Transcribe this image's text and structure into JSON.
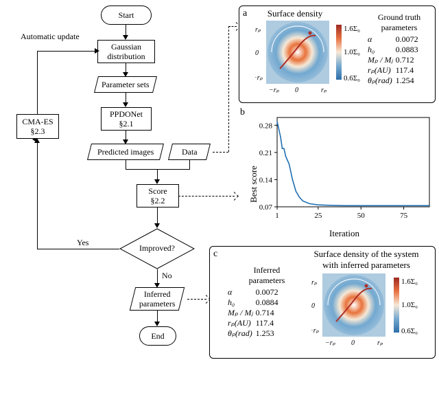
{
  "flow": {
    "start": "Start",
    "gauss": "Gaussian\ndistribution",
    "params": "Parameter sets",
    "ppdo": "PPDONet\n§2.1",
    "pred": "Predicted images",
    "data": "Data",
    "score": "Score\n§2.2",
    "decision": "Improved?",
    "infer": "Inferred\nparameters",
    "end": "End",
    "cmaes": "CMA-ES\n§2.3",
    "auto": "Automatic update",
    "yes": "Yes",
    "no": "No"
  },
  "panel_a": {
    "letter": "a",
    "title": "Surface density",
    "table_title": "Ground truth\nparameters",
    "rows": [
      {
        "k": "α",
        "v": "0.0072"
      },
      {
        "k": "h₀",
        "v": "0.0883"
      },
      {
        "k": "Mₚ / Mⱼ",
        "v": "0.712"
      },
      {
        "k": "rₚ(AU)",
        "v": "117.4"
      },
      {
        "k": "θₚ(rad)",
        "v": "1.254"
      }
    ],
    "cbar": [
      "1.6Σ₀",
      "1.0Σ₀",
      "0.6Σ₀"
    ],
    "axis": {
      "neg": "−rₚ",
      "zero": "0",
      "pos": "rₚ"
    }
  },
  "panel_b": {
    "letter": "b",
    "ylabel": "Best score",
    "xlabel": "Iteration",
    "yticks": [
      "0.28",
      "0.21",
      "0.14",
      "0.07"
    ],
    "xticks": [
      "1",
      "25",
      "50",
      "75"
    ]
  },
  "panel_c": {
    "letter": "c",
    "table_title": "Inferred\nparameters",
    "img_title": "Surface density of the system\nwith inferred parameters",
    "rows": [
      {
        "k": "α",
        "v": "0.0072"
      },
      {
        "k": "h₀",
        "v": "0.0884"
      },
      {
        "k": "Mₚ / Mⱼ",
        "v": "0.714"
      },
      {
        "k": "rₚ(AU)",
        "v": "117.4"
      },
      {
        "k": "θₚ(rad)",
        "v": "1.253"
      }
    ],
    "cbar": [
      "1.6Σ₀",
      "1.0Σ₀",
      "0.6Σ₀"
    ],
    "axis": {
      "neg": "−rₚ",
      "zero": "0",
      "pos": "rₚ"
    }
  },
  "chart_data": {
    "type": "line",
    "title": "",
    "xlabel": "Iteration",
    "ylabel": "Best score",
    "xlim": [
      1,
      90
    ],
    "ylim": [
      0.07,
      0.3
    ],
    "x": [
      1,
      2,
      3,
      4,
      5,
      6,
      8,
      10,
      12,
      14,
      16,
      20,
      25,
      30,
      40,
      50,
      60,
      70,
      80,
      90
    ],
    "values": [
      0.29,
      0.27,
      0.25,
      0.22,
      0.22,
      0.2,
      0.18,
      0.14,
      0.11,
      0.095,
      0.085,
      0.078,
      0.075,
      0.074,
      0.073,
      0.073,
      0.073,
      0.073,
      0.073,
      0.073
    ]
  },
  "colors": {
    "line": "#1f6fb2",
    "cbar_top": "#b03028",
    "cbar_mid": "#f0926a",
    "cbar_low": "#327db8"
  }
}
